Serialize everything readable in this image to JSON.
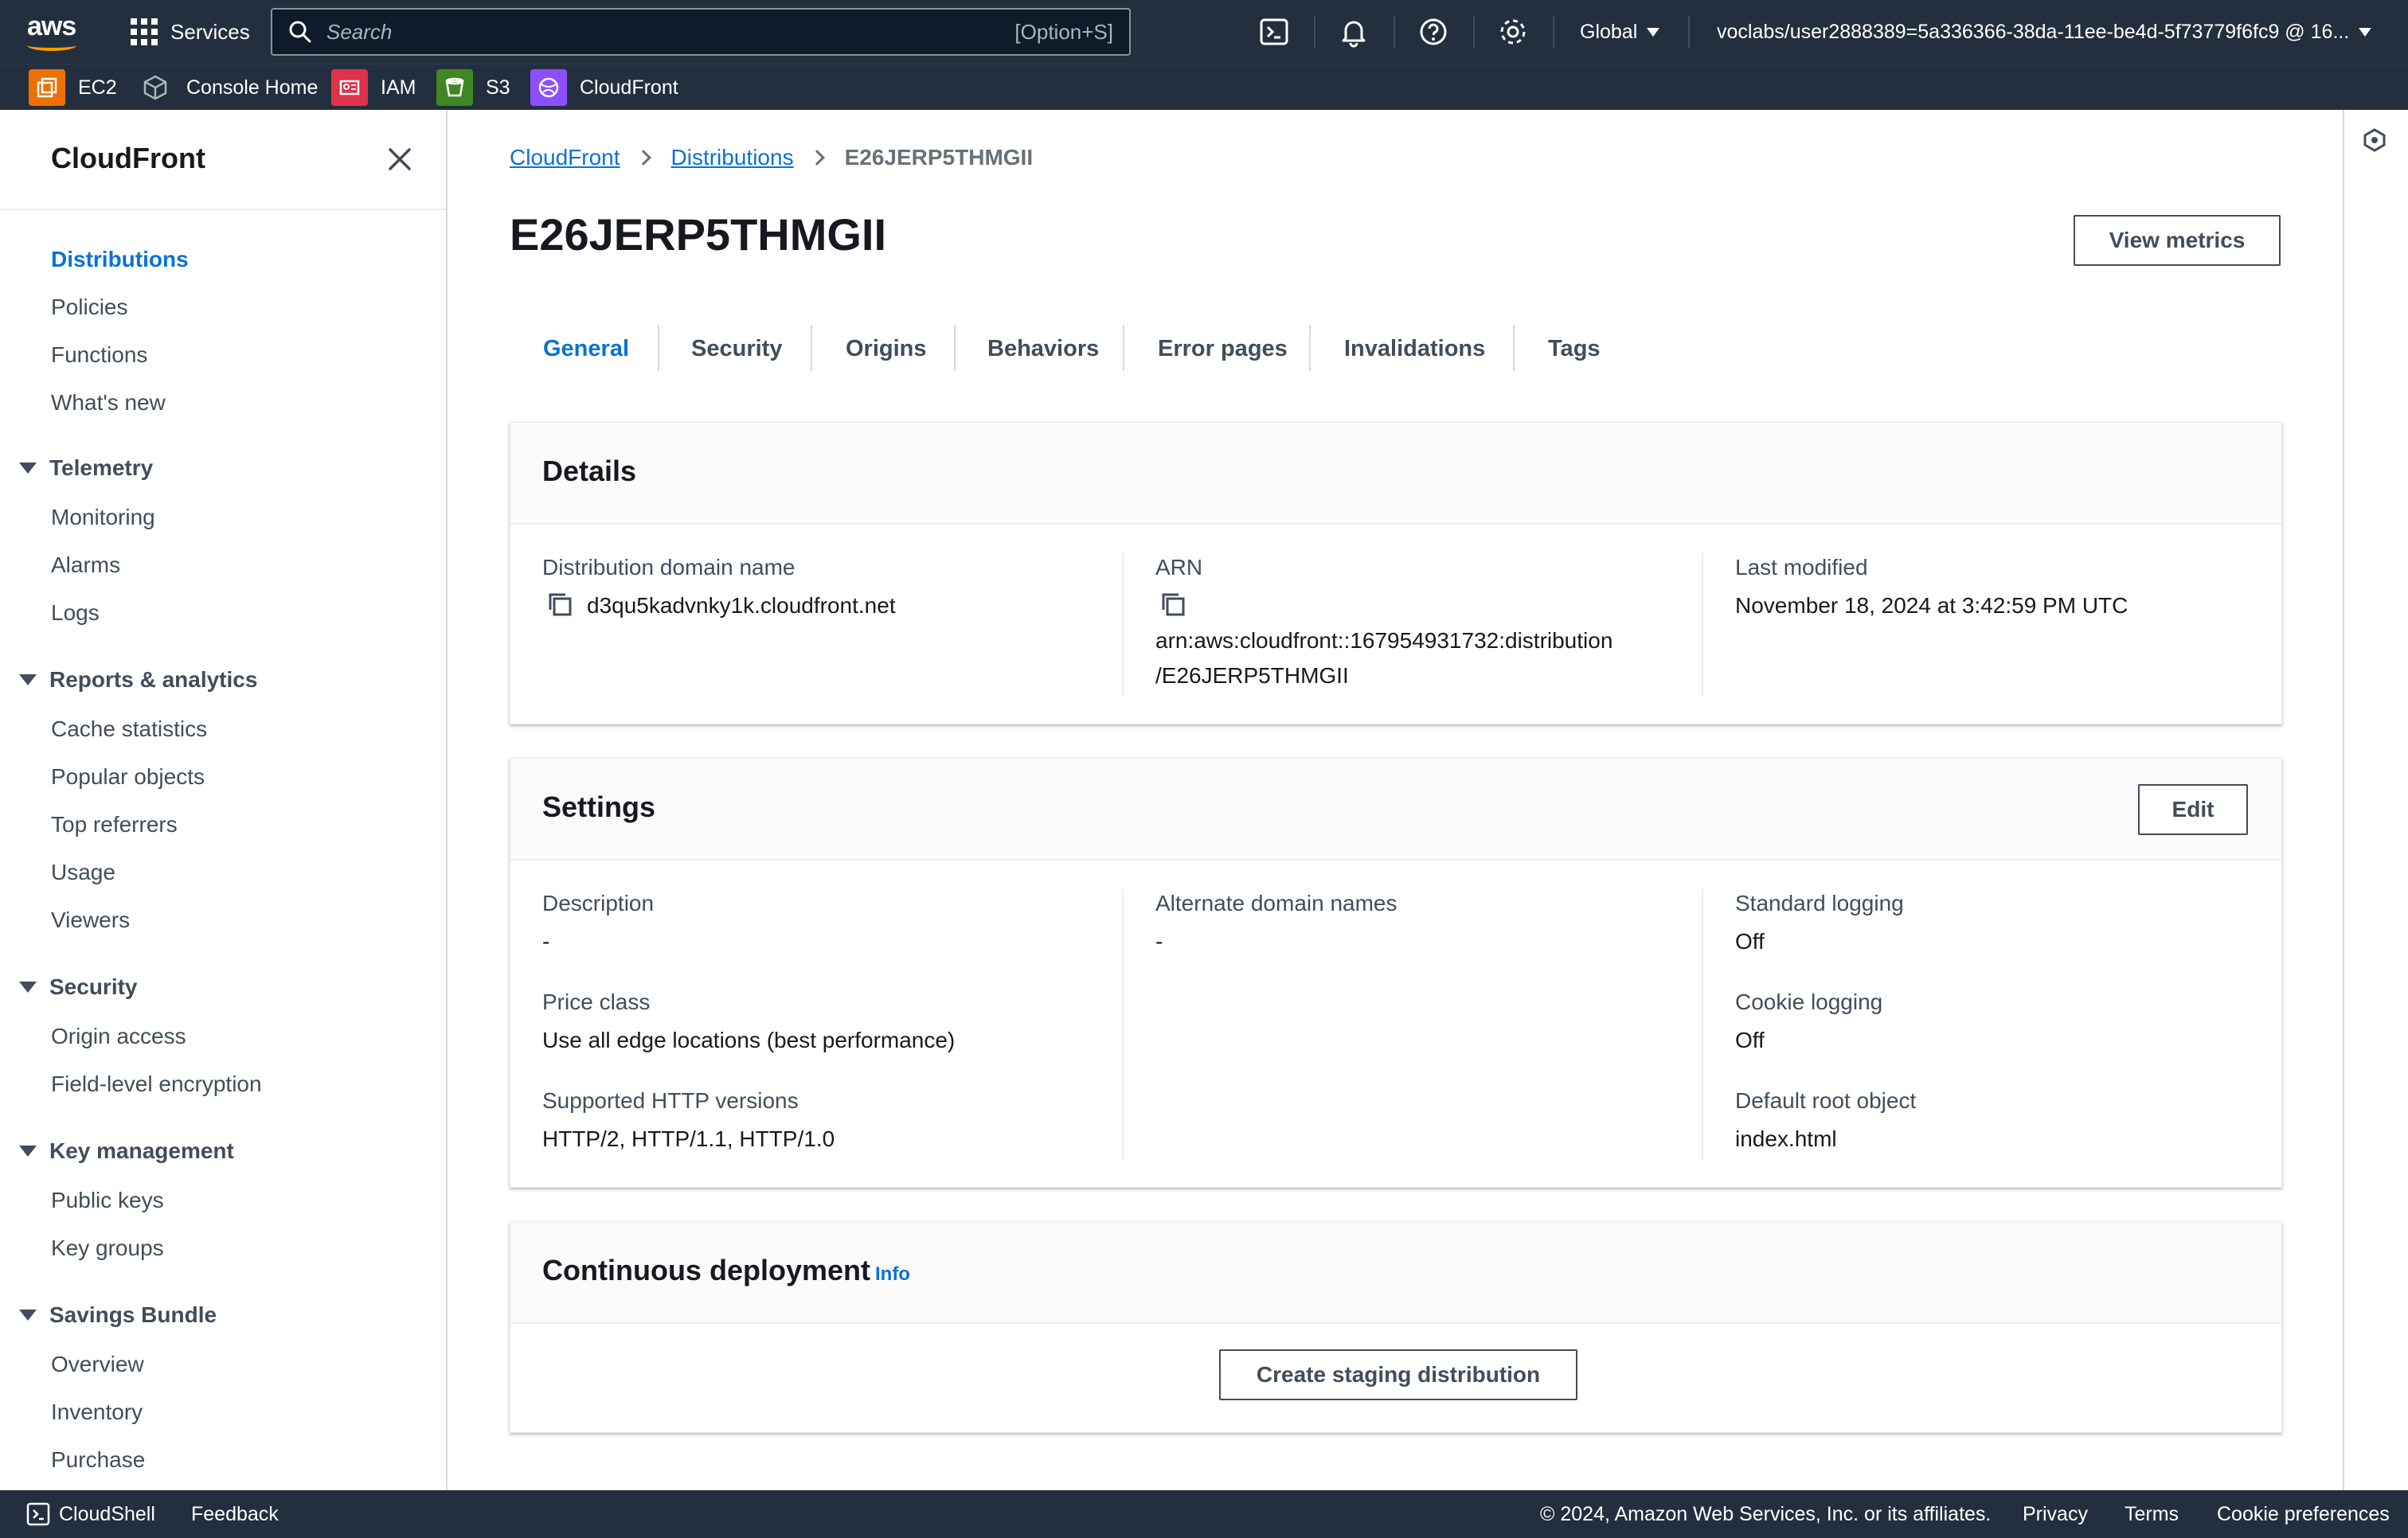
{
  "topbar": {
    "services_label": "Services",
    "search_placeholder": "Search",
    "search_shortcut": "[Option+S]",
    "region_label": "Global",
    "account_label": "voclabs/user2888389=5a336366-38da-11ee-be4d-5f73779f6fc9 @ 16..."
  },
  "favorites": [
    {
      "label": "EC2",
      "icon": "ec2-icon",
      "color": "#ed7100"
    },
    {
      "label": "Console Home",
      "icon": "cube-icon",
      "color": "#414d5c"
    },
    {
      "label": "IAM",
      "icon": "iam-icon",
      "color": "#dd344c"
    },
    {
      "label": "S3",
      "icon": "s3-icon",
      "color": "#3f8624"
    },
    {
      "label": "CloudFront",
      "icon": "cloudfront-icon",
      "color": "#8c4fff"
    }
  ],
  "sidenav": {
    "title": "CloudFront",
    "top_items": [
      "Distributions",
      "Policies",
      "Functions",
      "What's new"
    ],
    "groups": [
      {
        "label": "Telemetry",
        "items": [
          "Monitoring",
          "Alarms",
          "Logs"
        ]
      },
      {
        "label": "Reports & analytics",
        "items": [
          "Cache statistics",
          "Popular objects",
          "Top referrers",
          "Usage",
          "Viewers"
        ]
      },
      {
        "label": "Security",
        "items": [
          "Origin access",
          "Field-level encryption"
        ]
      },
      {
        "label": "Key management",
        "items": [
          "Public keys",
          "Key groups"
        ]
      },
      {
        "label": "Savings Bundle",
        "items": [
          "Overview",
          "Inventory",
          "Purchase"
        ]
      }
    ]
  },
  "breadcrumb": {
    "items": [
      "CloudFront",
      "Distributions"
    ],
    "current": "E26JERP5THMGII"
  },
  "page": {
    "title": "E26JERP5THMGII",
    "view_metrics_label": "View metrics"
  },
  "tabs": [
    "General",
    "Security",
    "Origins",
    "Behaviors",
    "Error pages",
    "Invalidations",
    "Tags"
  ],
  "details": {
    "title": "Details",
    "domain_label": "Distribution domain name",
    "domain_value": "d3qu5kadvnky1k.cloudfront.net",
    "arn_label": "ARN",
    "arn_line1": "arn:aws:cloudfront::167954931732:distribution",
    "arn_line2": "/E26JERP5THMGII",
    "modified_label": "Last modified",
    "modified_value": "November 18, 2024 at 3:42:59 PM UTC"
  },
  "settings": {
    "title": "Settings",
    "edit_label": "Edit",
    "description_label": "Description",
    "description_value": "-",
    "price_label": "Price class",
    "price_value": "Use all edge locations (best performance)",
    "http_label": "Supported HTTP versions",
    "http_value": "HTTP/2, HTTP/1.1, HTTP/1.0",
    "alt_label": "Alternate domain names",
    "alt_value": "-",
    "std_log_label": "Standard logging",
    "std_log_value": "Off",
    "cookie_label": "Cookie logging",
    "cookie_value": "Off",
    "root_label": "Default root object",
    "root_value": "index.html"
  },
  "deployment": {
    "title": "Continuous deployment",
    "info_label": "Info",
    "create_label": "Create staging distribution"
  },
  "footer": {
    "cloudshell": "CloudShell",
    "feedback": "Feedback",
    "copyright": "© 2024, Amazon Web Services, Inc. or its affiliates.",
    "privacy": "Privacy",
    "terms": "Terms",
    "cookie_prefs": "Cookie preferences"
  },
  "colors": {
    "accent": "#0972d3",
    "nav_bg": "#232f3e",
    "aws_orange": "#ff9900"
  }
}
